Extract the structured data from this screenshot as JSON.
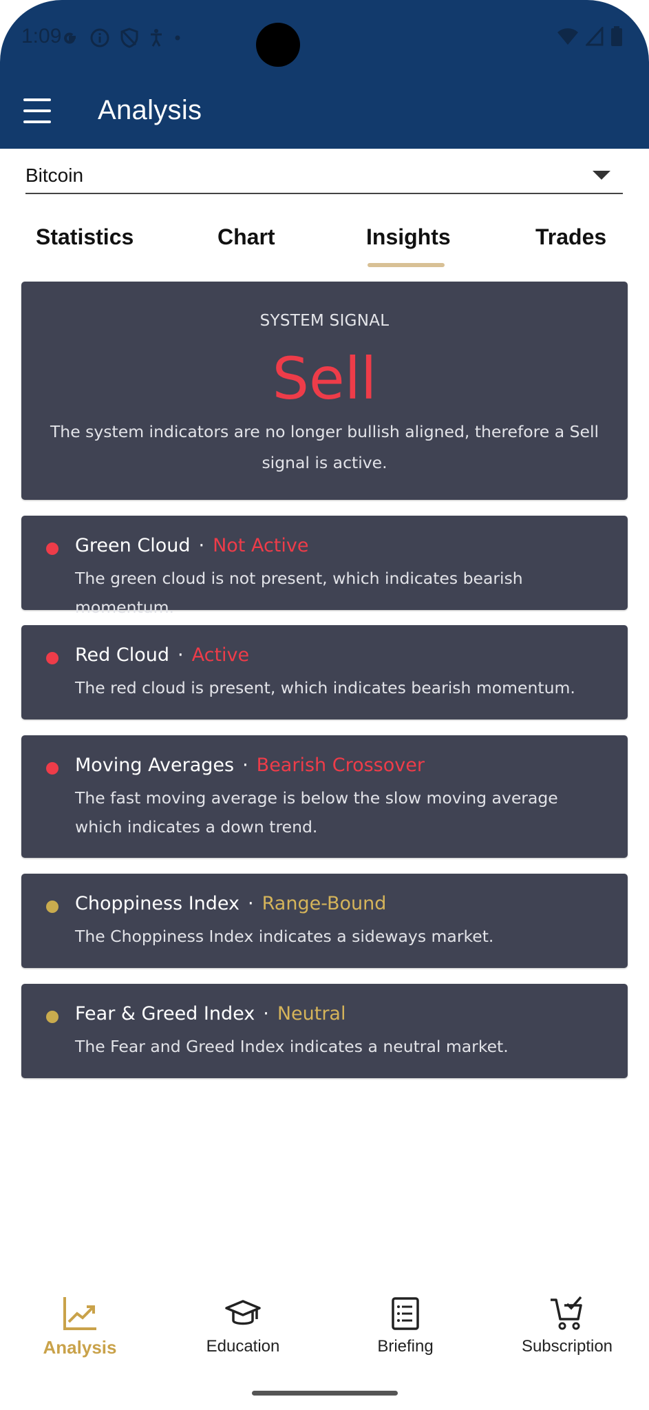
{
  "status_bar": {
    "time": "1:09",
    "icons": [
      "google-icon",
      "info-icon",
      "shield-icon",
      "accessibility-icon",
      "dot-icon",
      "wifi-icon",
      "signal-icon",
      "battery-icon"
    ]
  },
  "header": {
    "title": "Analysis",
    "menu_icon": "hamburger-menu-icon"
  },
  "asset_selector": {
    "value": "Bitcoin"
  },
  "tabs": [
    {
      "label": "Statistics"
    },
    {
      "label": "Chart"
    },
    {
      "label": "Insights",
      "active": true
    },
    {
      "label": "Trades"
    }
  ],
  "signal": {
    "label": "SYSTEM SIGNAL",
    "value": "Sell",
    "description": "The system indicators are no longer bullish aligned, therefore a Sell signal is active."
  },
  "indicators": [
    {
      "name": "Green Cloud",
      "separator": "·",
      "status": "Not Active",
      "status_color": "#ee3c49",
      "dot_color": "#ee3c49",
      "description": "The green cloud is not present, which indicates bearish momentum."
    },
    {
      "name": "Red Cloud",
      "separator": "·",
      "status": "Active",
      "status_color": "#ee3c49",
      "dot_color": "#ee3c49",
      "description": "The red cloud is present, which indicates bearish momentum."
    },
    {
      "name": "Moving Averages",
      "separator": "·",
      "status": "Bearish Crossover",
      "status_color": "#ee3c49",
      "dot_color": "#ee3c49",
      "description": "The fast moving average is below the slow moving average which indicates a down trend."
    },
    {
      "name": "Choppiness Index",
      "separator": "·",
      "status": "Range-Bound",
      "status_color": "#d5b45a",
      "dot_color": "#c9ab4e",
      "description": "The Choppiness Index indicates a sideways market."
    },
    {
      "name": "Fear & Greed Index",
      "separator": "·",
      "status": "Neutral",
      "status_color": "#d5b45a",
      "dot_color": "#c9ab4e",
      "description": "The Fear and Greed Index indicates a neutral market."
    }
  ],
  "bottom_nav": [
    {
      "label": "Analysis",
      "icon": "chart-trend-icon",
      "active": true
    },
    {
      "label": "Education",
      "icon": "graduation-cap-icon"
    },
    {
      "label": "Briefing",
      "icon": "document-icon"
    },
    {
      "label": "Subscription",
      "icon": "cart-check-icon"
    }
  ],
  "colors": {
    "header_bg": "#123a6c",
    "card_bg": "#404353",
    "sell_red": "#ee3c49",
    "neutral_gold": "#d5b45a",
    "tab_indicator": "#d8c095",
    "active_nav": "#c9a24a"
  }
}
